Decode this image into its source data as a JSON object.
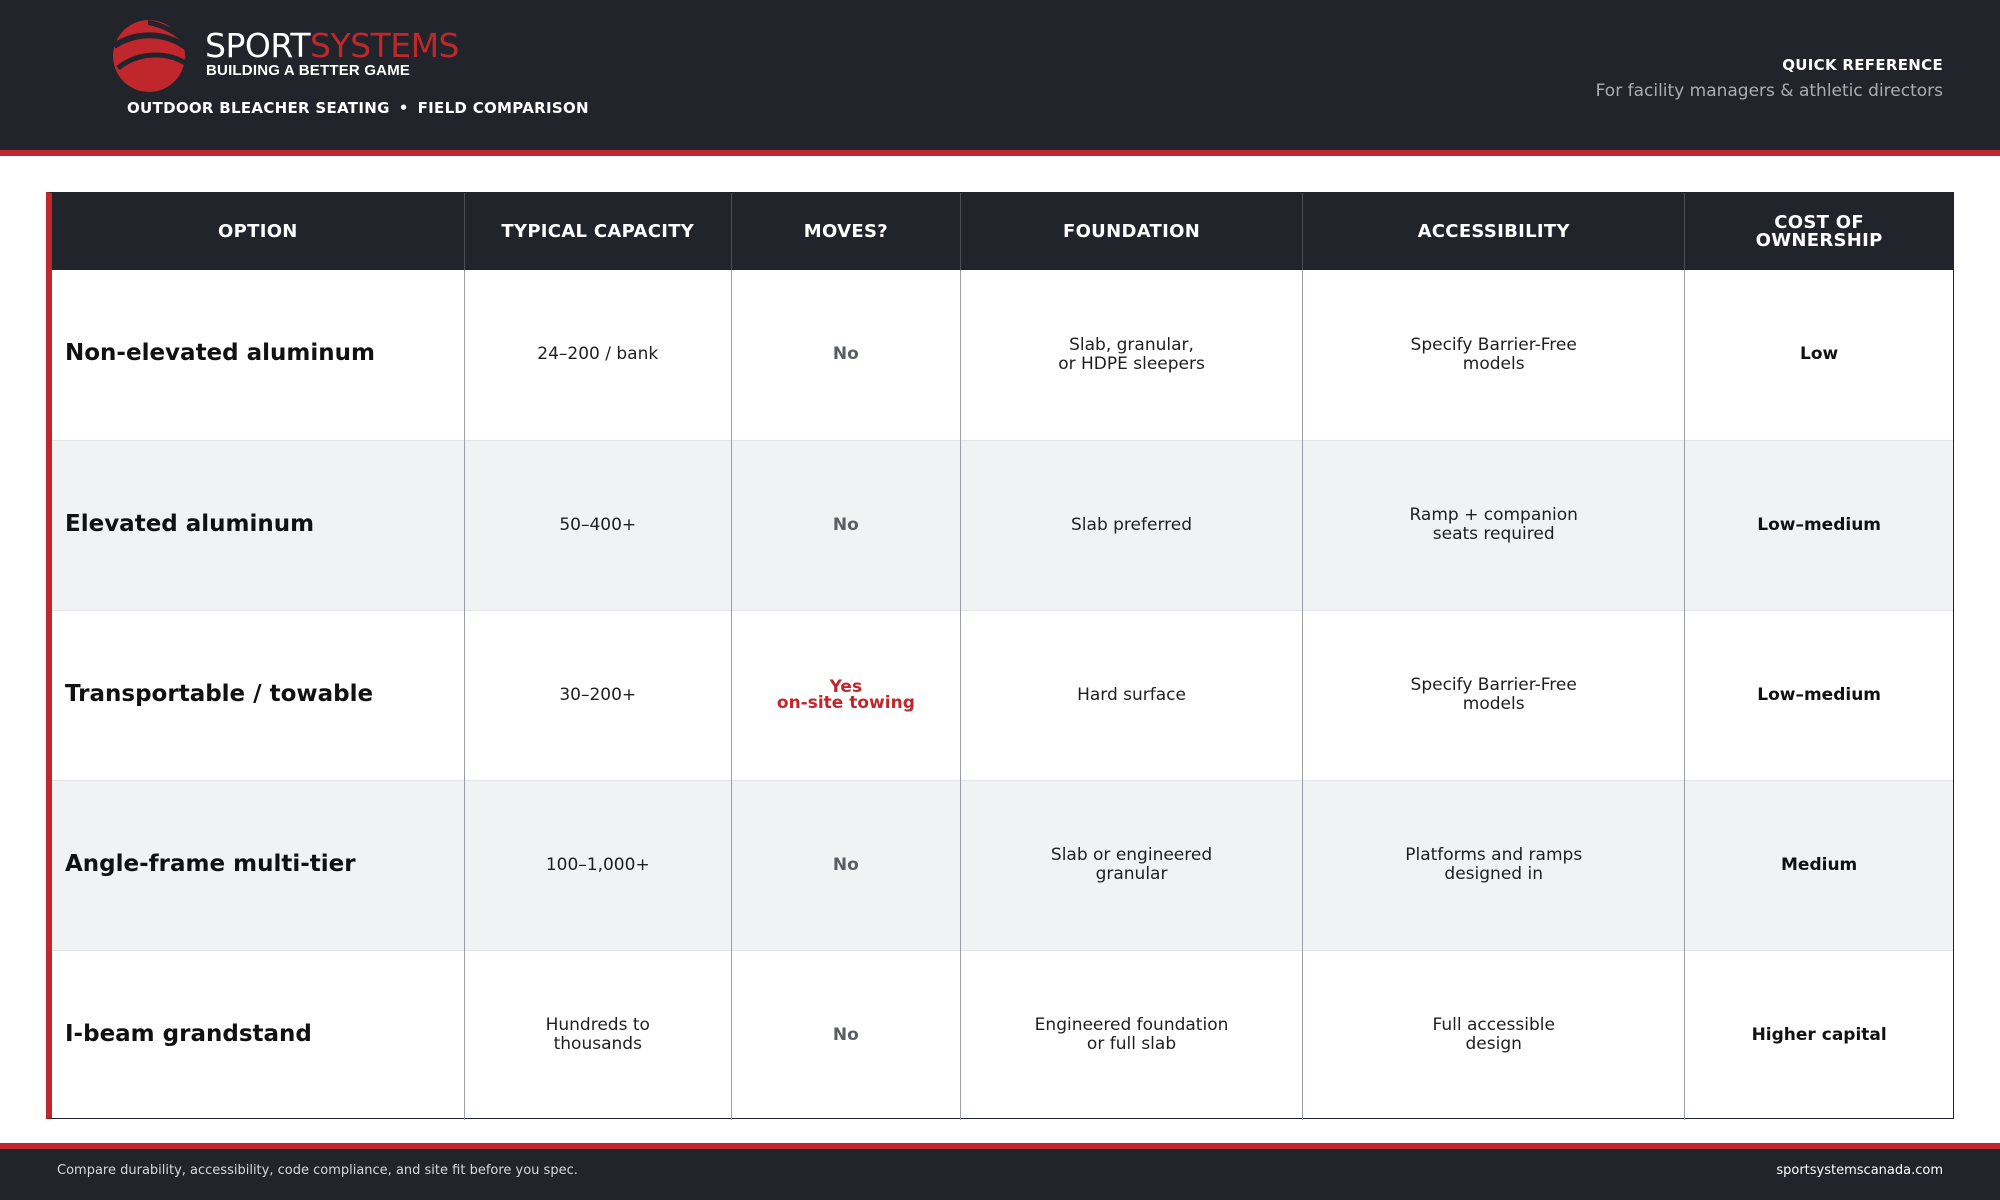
{
  "brand": {
    "name_part1": "SPORT",
    "name_part2": "SYSTEMS",
    "tagline": "BUILDING A BETTER GAME",
    "accent_color": "#c0272d",
    "dark_color": "#21242b"
  },
  "header": {
    "subtitle_left": "OUTDOOR BLEACHER SEATING",
    "subtitle_separator": "•",
    "subtitle_right": "FIELD COMPARISON",
    "quick_ref": "QUICK REFERENCE",
    "audience": "For facility managers & athletic directors"
  },
  "table": {
    "columns": [
      {
        "lines": [
          "OPTION"
        ]
      },
      {
        "lines": [
          "TYPICAL CAPACITY"
        ]
      },
      {
        "lines": [
          "MOVES?"
        ]
      },
      {
        "lines": [
          "FOUNDATION"
        ]
      },
      {
        "lines": [
          "ACCESSIBILITY"
        ]
      },
      {
        "lines": [
          "COST OF",
          "OWNERSHIP"
        ]
      }
    ],
    "rows": [
      {
        "option": "Non-elevated aluminum",
        "capacity": [
          "24–200 / bank"
        ],
        "moves": [
          "No"
        ],
        "moves_highlight": false,
        "foundation": [
          "Slab, granular,",
          "or HDPE sleepers"
        ],
        "accessibility": [
          "Specify Barrier-Free",
          "models"
        ],
        "cost": "Low"
      },
      {
        "option": "Elevated aluminum",
        "capacity": [
          "50–400+"
        ],
        "moves": [
          "No"
        ],
        "moves_highlight": false,
        "foundation": [
          "Slab preferred"
        ],
        "accessibility": [
          "Ramp + companion",
          "seats required"
        ],
        "cost": "Low–medium"
      },
      {
        "option": "Transportable / towable",
        "capacity": [
          "30–200+"
        ],
        "moves": [
          "Yes",
          "on-site towing"
        ],
        "moves_highlight": true,
        "foundation": [
          "Hard surface"
        ],
        "accessibility": [
          "Specify Barrier-Free",
          "models"
        ],
        "cost": "Low–medium"
      },
      {
        "option": "Angle-frame multi-tier",
        "capacity": [
          "100–1,000+"
        ],
        "moves": [
          "No"
        ],
        "moves_highlight": false,
        "foundation": [
          "Slab or engineered",
          "granular"
        ],
        "accessibility": [
          "Platforms and ramps",
          "designed in"
        ],
        "cost": "Medium"
      },
      {
        "option": "I-beam grandstand",
        "capacity": [
          "Hundreds to",
          "thousands"
        ],
        "moves": [
          "No"
        ],
        "moves_highlight": false,
        "foundation": [
          "Engineered foundation",
          "or full slab"
        ],
        "accessibility": [
          "Full accessible",
          "design"
        ],
        "cost": "Higher capital"
      }
    ]
  },
  "footer": {
    "note": "Compare durability, accessibility, code compliance, and site fit before you spec.",
    "website": "sportsystemscanada.com"
  }
}
